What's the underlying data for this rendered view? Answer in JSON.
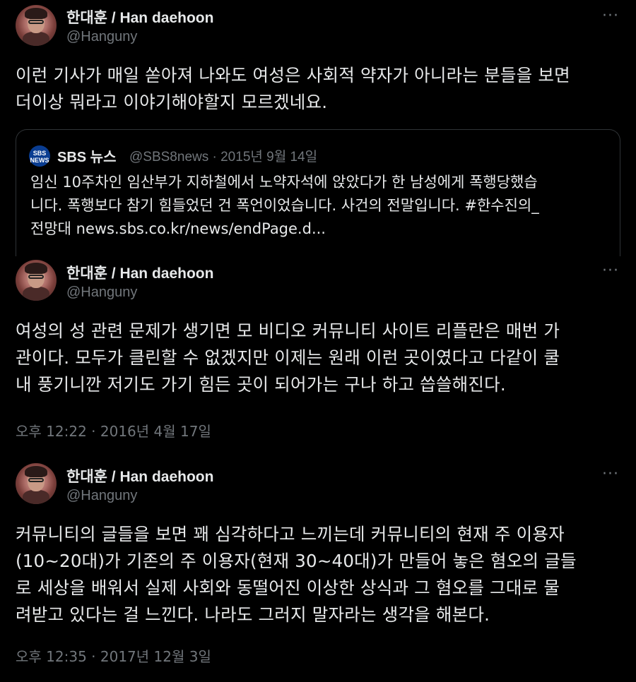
{
  "tweets": [
    {
      "author_name": "한대훈 / Han daehoon",
      "handle": "@Hanguny",
      "more_icon": "more-horizontal-icon",
      "text_lines": [
        "이런 기사가 매일 쏟아져 나와도 여성은 사회적 약자가 아니라는 분들을 보면",
        "더이상 뭐라고 이야기해야할지 모르겠네요."
      ],
      "quote": {
        "logo_text": "SBS NEWS",
        "name": "SBS 뉴스",
        "meta": "@SBS8news · 2015년 9월 14일",
        "text_lines": [
          "임신 10주차인 임산부가 지하철에서 노약자석에 앉았다가 한 남성에게 폭행당했습",
          "니다. 폭행보다 참기 힘들었던 건 폭언이었습니다. 사건의 전말입니다. #한수진의_",
          "전망대 news.sbs.co.kr/news/endPage.d..."
        ]
      }
    },
    {
      "author_name": "한대훈 / Han daehoon",
      "handle": "@Hanguny",
      "more_icon": "more-horizontal-icon",
      "text_lines": [
        "여성의 성 관련 문제가 생기면 모 비디오 커뮤니티 사이트 리플란은 매번 가",
        "관이다. 모두가 클린할 수 없겠지만 이제는 원래 이런 곳이였다고 다같이 쿨",
        "내 풍기니깐 저기도 가기 힘든 곳이 되어가는 구나 하고 씁쓸해진다."
      ],
      "timestamp": "오후 12:22 · 2016년 4월 17일"
    },
    {
      "author_name": "한대훈 / Han daehoon",
      "handle": "@Hanguny",
      "more_icon": "more-horizontal-icon",
      "text_lines": [
        "커뮤니티의 글들을 보면 꽤 심각하다고 느끼는데 커뮤니티의 현재 주 이용자",
        "(10~20대)가 기존의 주 이용자(현재 30~40대)가 만들어 놓은 혐오의 글들",
        "로 세상을 배워서 실제 사회와 동떨어진 이상한 상식과 그 혐오를 그대로 물",
        "려받고 있다는 걸 느낀다. 나라도 그러지 말자라는 생각을 해본다."
      ],
      "timestamp": "오후 12:35 · 2017년 12월 3일"
    }
  ],
  "colors": {
    "background": "#000000",
    "primary_text": "#e7e9ea",
    "secondary_text": "#71767b",
    "border": "#2f3336",
    "sbs_logo": "#0a3d91"
  }
}
